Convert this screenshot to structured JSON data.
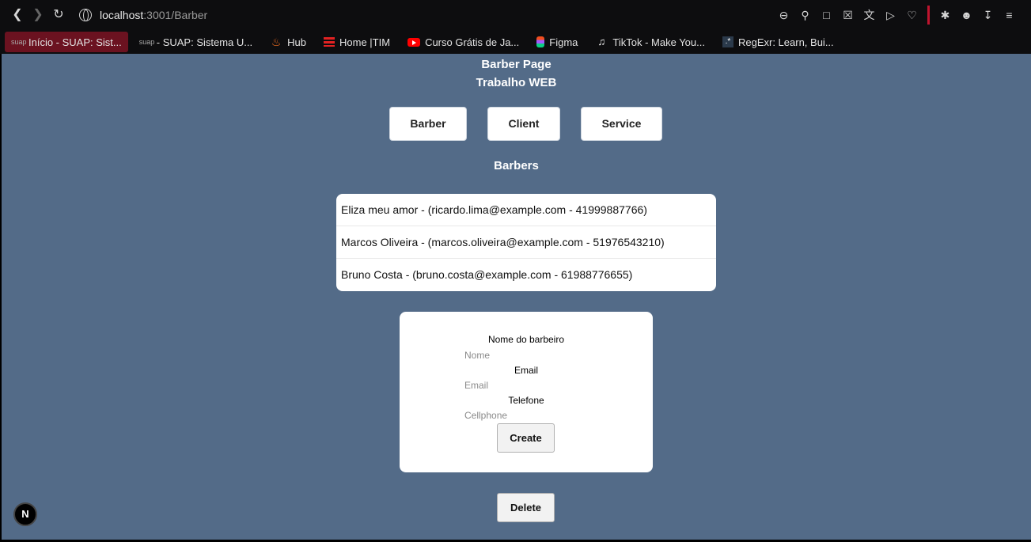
{
  "browser": {
    "url_host": "localhost",
    "url_path": ":3001/Barber",
    "bookmarks": [
      {
        "icon": "suap-icon",
        "label": "Início - SUAP: Sist..."
      },
      {
        "icon": "suap-icon",
        "label": "- SUAP: Sistema U..."
      },
      {
        "icon": "fire-icon",
        "label": "Hub"
      },
      {
        "icon": "tim-icon",
        "label": "Home |TIM"
      },
      {
        "icon": "youtube-icon",
        "label": "Curso Grátis de Ja..."
      },
      {
        "icon": "figma-icon",
        "label": "Figma"
      },
      {
        "icon": "tiktok-icon",
        "label": "TikTok - Make You..."
      },
      {
        "icon": "regexr-icon",
        "label": "RegExr: Learn, Bui..."
      }
    ]
  },
  "header": {
    "title": "Barber Page",
    "subtitle": "Trabalho WEB"
  },
  "nav": {
    "barber": "Barber",
    "client": "Client",
    "service": "Service"
  },
  "section_title": "Barbers",
  "barbers": [
    "Eliza meu amor - (ricardo.lima@example.com - 41999887766)",
    "Marcos Oliveira - (marcos.oliveira@example.com - 51976543210)",
    "Bruno Costa - (bruno.costa@example.com - 61988776655)"
  ],
  "form": {
    "name_label": "Nome do barbeiro",
    "name_placeholder": "Nome",
    "email_label": "Email",
    "email_placeholder": "Email",
    "phone_label": "Telefone",
    "phone_placeholder": "Cellphone",
    "create_label": "Create"
  },
  "delete_label": "Delete",
  "badge": "N",
  "colors": {
    "page_bg": "#536b88",
    "chrome_bg": "#0d0d0f",
    "active_bookmark": "#6b1220"
  }
}
